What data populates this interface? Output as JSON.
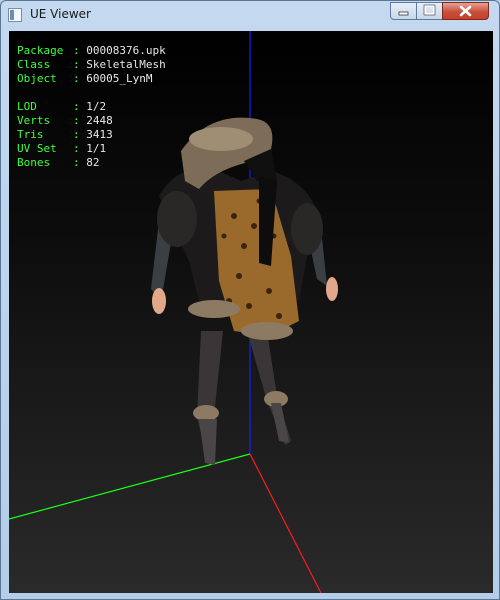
{
  "window": {
    "title": "UE Viewer"
  },
  "info": {
    "package_label": "Package",
    "package_value": "00008376.upk",
    "class_label": "Class",
    "class_value": "SkeletalMesh",
    "object_label": "Object",
    "object_value": "60005_LynM",
    "lod_label": "LOD",
    "lod_value": "1/2",
    "verts_label": "Verts",
    "verts_value": "2448",
    "tris_label": "Tris",
    "tris_value": "3413",
    "uvset_label": "UV Set",
    "uvset_value": "1/1",
    "bones_label": "Bones",
    "bones_value": "82",
    "separator": ": "
  },
  "colors": {
    "label": "#3dff3d",
    "value": "#e8e8e8",
    "axis_x": "#ff1a1a",
    "axis_y": "#1aff1a",
    "axis_z": "#1a1aff",
    "background_top": "#000000",
    "background_bottom": "#2a2a2a"
  },
  "icons": {
    "app": "window-app-icon",
    "minimize": "minimize-icon",
    "maximize": "maximize-icon",
    "close": "close-icon"
  }
}
